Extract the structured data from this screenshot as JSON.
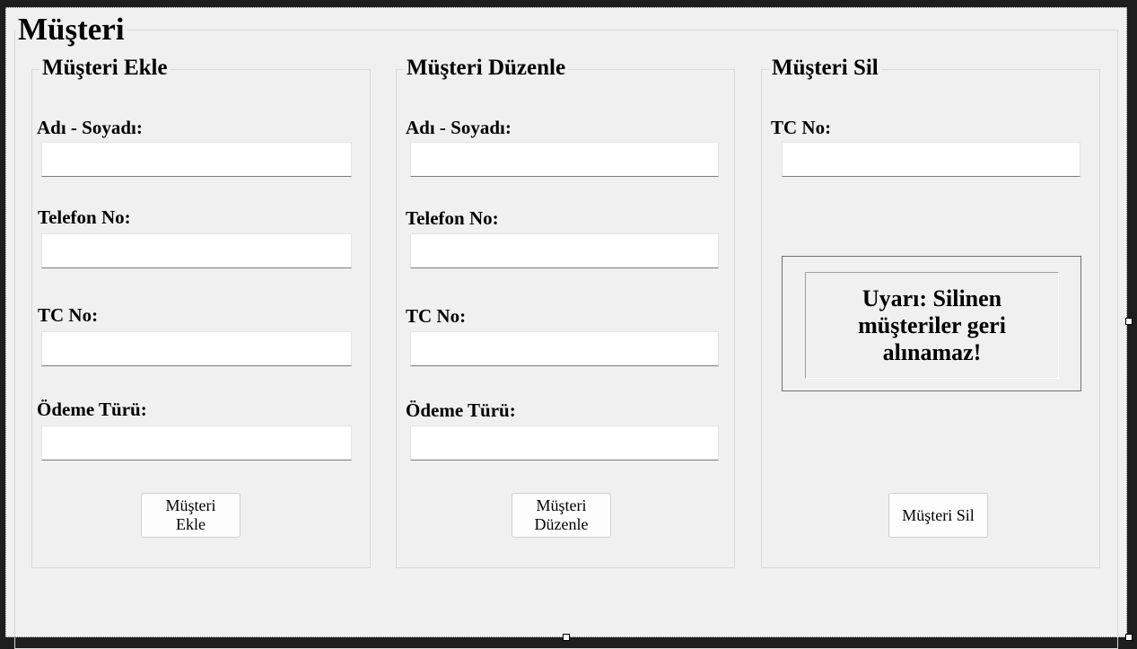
{
  "main_title": "Müşteri",
  "add_group": {
    "title": "Müşteri Ekle",
    "fields": [
      {
        "label": "Adı - Soyadı:",
        "value": ""
      },
      {
        "label": "Telefon No:",
        "value": ""
      },
      {
        "label": "TC No:",
        "value": ""
      },
      {
        "label": "Ödeme Türü:",
        "value": ""
      }
    ],
    "button": "Müşteri Ekle"
  },
  "edit_group": {
    "title": "Müşteri Düzenle",
    "fields": [
      {
        "label": "Adı - Soyadı:",
        "value": ""
      },
      {
        "label": "Telefon No:",
        "value": ""
      },
      {
        "label": "TC No:",
        "value": ""
      },
      {
        "label": "Ödeme Türü:",
        "value": ""
      }
    ],
    "button": "Müşteri Düzenle"
  },
  "delete_group": {
    "title": "Müşteri Sil",
    "tc_label": "TC No:",
    "tc_value": "",
    "warning": "Uyarı: Silinen müşteriler geri alınamaz!",
    "button": "Müşteri Sil"
  }
}
